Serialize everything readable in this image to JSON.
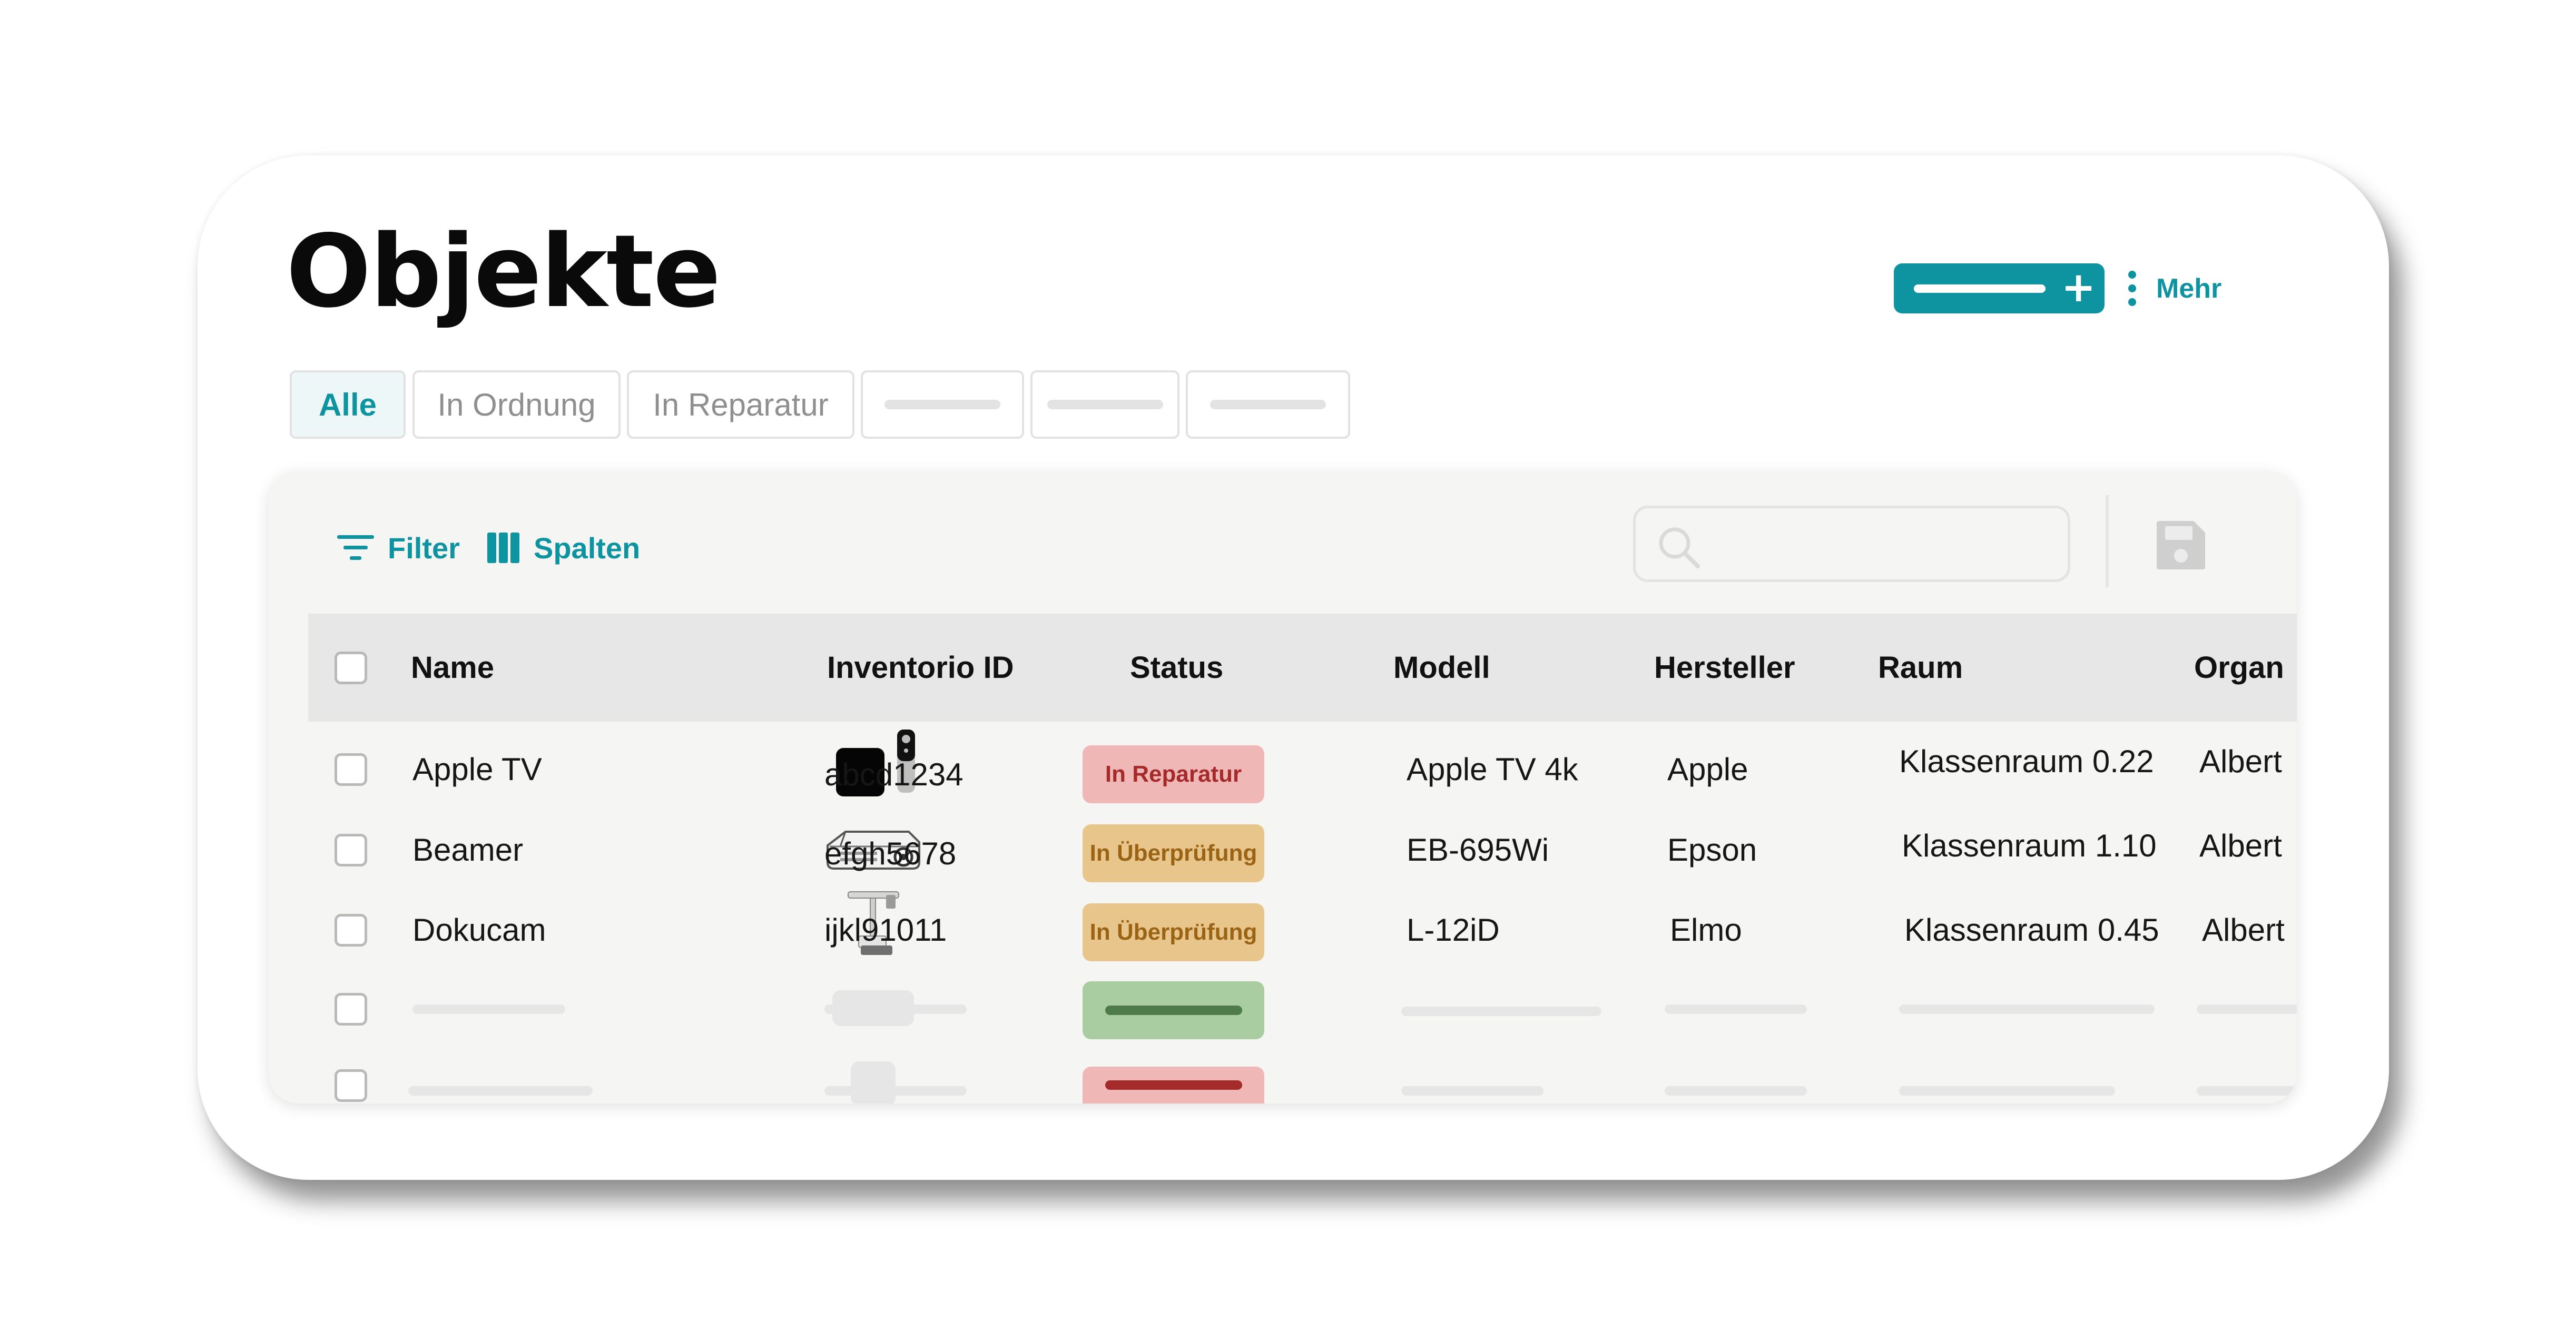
{
  "page": {
    "title": "Objekte"
  },
  "header": {
    "more_label": "Mehr"
  },
  "tabs": [
    {
      "label": "Alle",
      "active": true
    },
    {
      "label": "In Ordnung"
    },
    {
      "label": "In Reparatur"
    },
    {
      "label": ""
    },
    {
      "label": ""
    },
    {
      "label": ""
    }
  ],
  "toolbar": {
    "filter_label": "Filter",
    "columns_label": "Spalten"
  },
  "table": {
    "columns": [
      "Name",
      "Inventorio ID",
      "Status",
      "Modell",
      "Hersteller",
      "Raum",
      "Organ"
    ],
    "rows": [
      {
        "name": "Apple TV",
        "thumb_icon": "apple-tv-icon",
        "inventory_id": "abcd1234",
        "status": "In Reparatur",
        "model": "Apple TV 4k",
        "manufacturer": "Apple",
        "room": "Klassenraum 0.22",
        "org": "Albert"
      },
      {
        "name": "Beamer",
        "thumb_icon": "projector-icon",
        "inventory_id": "efgh5678",
        "status": "In Überprüfung",
        "model": "EB-695Wi",
        "manufacturer": "Epson",
        "room": "Klassenraum 1.10",
        "org": "Albert"
      },
      {
        "name": "Dokucam",
        "thumb_icon": "document-camera-icon",
        "inventory_id": "ijkl91011",
        "status": "In Überprüfung",
        "model": "L-12iD",
        "manufacturer": "Elmo",
        "room": "Klassenraum 0.45",
        "org": "Albert"
      }
    ]
  },
  "colors": {
    "accent": "#0e94a0",
    "status_repair_bg": "#efb8b7",
    "status_review_bg": "#e8c58a",
    "status_ok_bg": "#a9cca0"
  }
}
